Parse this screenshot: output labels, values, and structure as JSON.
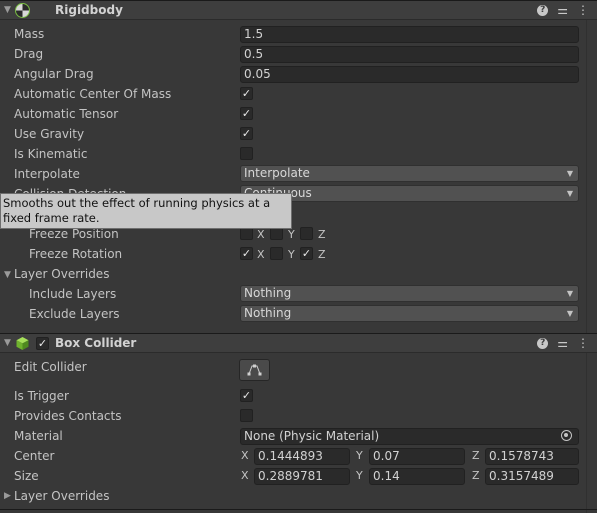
{
  "rigidbody": {
    "title": "Rigidbody",
    "mass_label": "Mass",
    "mass": "1.5",
    "drag_label": "Drag",
    "drag": "0.5",
    "angular_drag_label": "Angular Drag",
    "angular_drag": "0.05",
    "auto_com_label": "Automatic Center Of Mass",
    "auto_com": true,
    "auto_tensor_label": "Automatic Tensor",
    "auto_tensor": true,
    "use_gravity_label": "Use Gravity",
    "use_gravity": true,
    "is_kinematic_label": "Is Kinematic",
    "is_kinematic": false,
    "interpolate_label": "Interpolate",
    "interpolate": "Interpolate",
    "collision_detection_label": "Collision Detection",
    "collision_detection": "Continuous",
    "freeze_position_label": "Freeze Position",
    "freeze_position": {
      "x": false,
      "y": false,
      "z": false
    },
    "freeze_rotation_label": "Freeze Rotation",
    "freeze_rotation": {
      "x": true,
      "y": false,
      "z": true
    },
    "axis_x": "X",
    "axis_y": "Y",
    "axis_z": "Z",
    "layer_overrides_label": "Layer Overrides",
    "include_layers_label": "Include Layers",
    "include_layers": "Nothing",
    "exclude_layers_label": "Exclude Layers",
    "exclude_layers": "Nothing"
  },
  "tooltip": {
    "text": "Smooths out the effect of running physics at a fixed frame rate."
  },
  "box_collider": {
    "title": "Box Collider",
    "enabled": true,
    "edit_collider_label": "Edit Collider",
    "is_trigger_label": "Is Trigger",
    "is_trigger": true,
    "provides_contacts_label": "Provides Contacts",
    "provides_contacts": false,
    "material_label": "Material",
    "material": "None (Physic Material)",
    "center_label": "Center",
    "center": {
      "x": "0.1444893",
      "y": "0.07",
      "z": "0.1578743"
    },
    "size_label": "Size",
    "size": {
      "x": "0.2889781",
      "y": "0.14",
      "z": "0.3157489"
    },
    "layer_overrides_label": "Layer Overrides"
  },
  "icons": [
    "rigidbody-icon",
    "help-icon",
    "preset-icon",
    "menu-icon",
    "box-collider-icon",
    "edit-collider-icon",
    "object-picker-icon"
  ]
}
